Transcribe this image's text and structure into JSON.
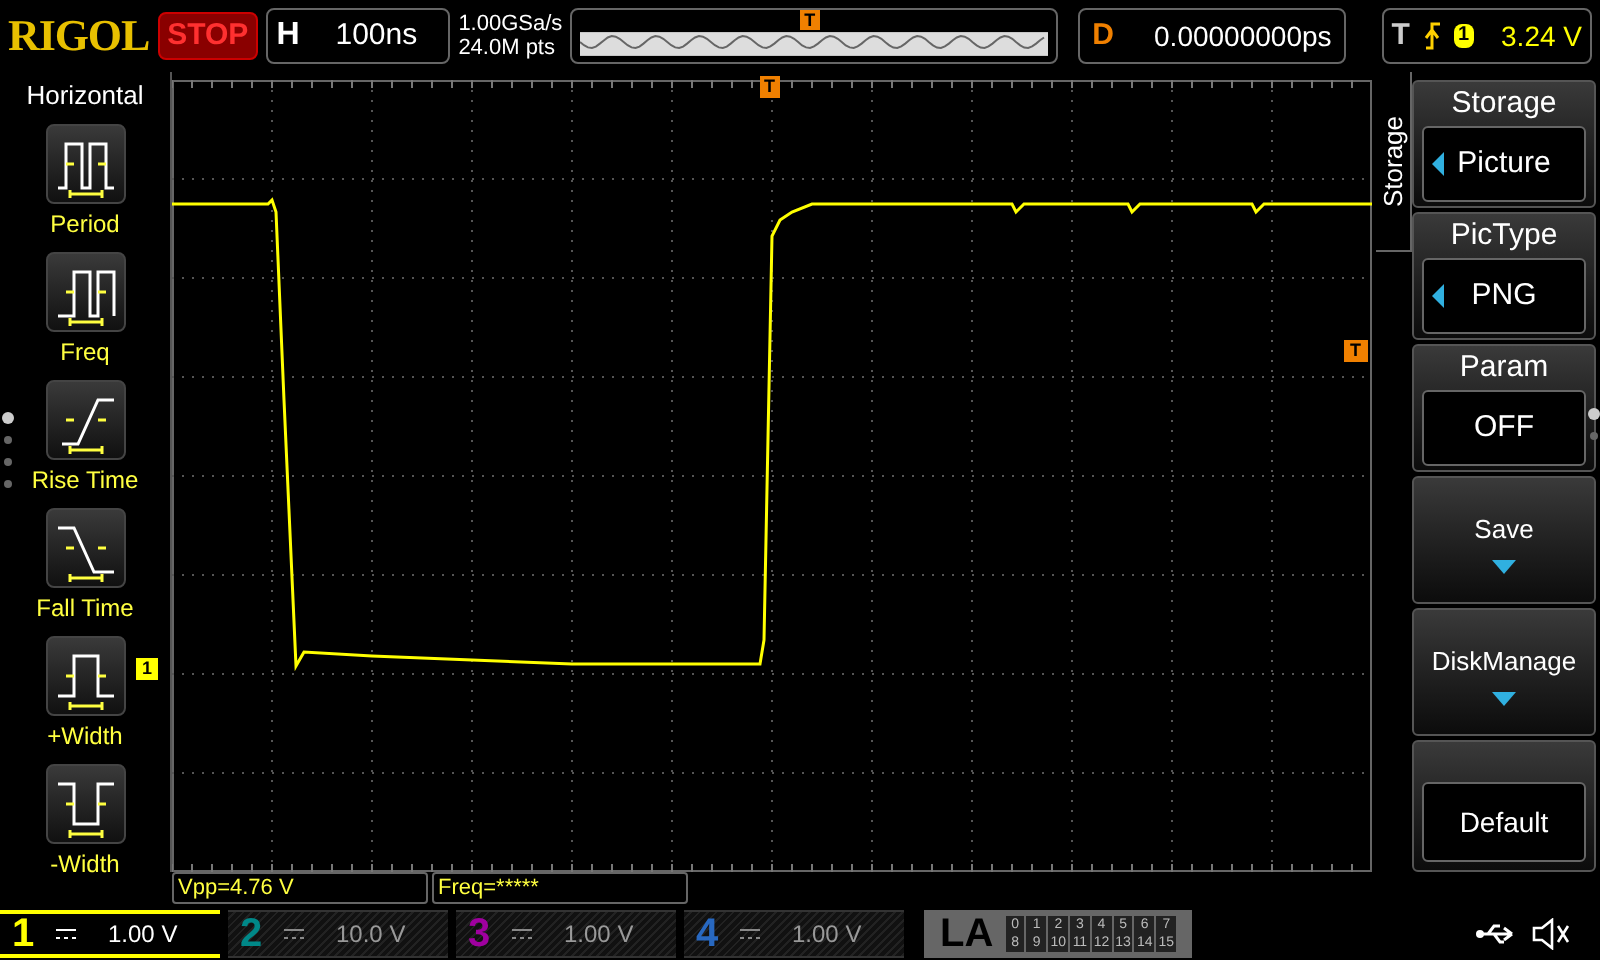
{
  "brand": "RIGOL",
  "run_state": "STOP",
  "horizontal": {
    "label": "H",
    "timebase": "100ns",
    "sample_rate": "1.00GSa/s",
    "memory_depth": "24.0M pts"
  },
  "trigger_position_marker": "T",
  "overview_trigger_marker": "T",
  "delay": {
    "label": "D",
    "value": "0.00000000ps"
  },
  "trigger": {
    "label": "T",
    "source": "1",
    "level": "3.24 V"
  },
  "left_menu": {
    "title": "Horizontal",
    "items": [
      {
        "label": "Period",
        "kind": "period"
      },
      {
        "label": "Freq",
        "kind": "freq"
      },
      {
        "label": "Rise Time",
        "kind": "rise"
      },
      {
        "label": "Fall Time",
        "kind": "fall"
      },
      {
        "label": "+Width",
        "kind": "pwidth"
      },
      {
        "label": "-Width",
        "kind": "nwidth"
      }
    ]
  },
  "markers": {
    "channel": "1",
    "trigger_level": "T"
  },
  "measurements": [
    "Vpp=4.76 V",
    "Freq=*****"
  ],
  "right_menu": {
    "tab": "Storage",
    "items": [
      {
        "kind": "option",
        "title": "Storage",
        "value": "Picture"
      },
      {
        "kind": "option",
        "title": "PicType",
        "value": "PNG"
      },
      {
        "kind": "toggle",
        "title": "Param",
        "value": "OFF"
      },
      {
        "kind": "submenu",
        "label": "Save"
      },
      {
        "kind": "submenu",
        "label": "DiskManage"
      },
      {
        "kind": "action",
        "label": "Default"
      }
    ]
  },
  "channels": [
    {
      "number": "1",
      "scale": "1.00 V",
      "on": true,
      "color": "#ffff00"
    },
    {
      "number": "2",
      "scale": "10.0 V",
      "on": false,
      "color": "#008888"
    },
    {
      "number": "3",
      "scale": "1.00 V",
      "on": false,
      "color": "#a000a0"
    },
    {
      "number": "4",
      "scale": "1.00 V",
      "on": false,
      "color": "#2868c0"
    }
  ],
  "la": {
    "label": "LA",
    "bits": [
      "0",
      "1",
      "2",
      "3",
      "4",
      "5",
      "6",
      "7",
      "8",
      "9",
      "10",
      "11",
      "12",
      "13",
      "14",
      "15"
    ]
  }
}
